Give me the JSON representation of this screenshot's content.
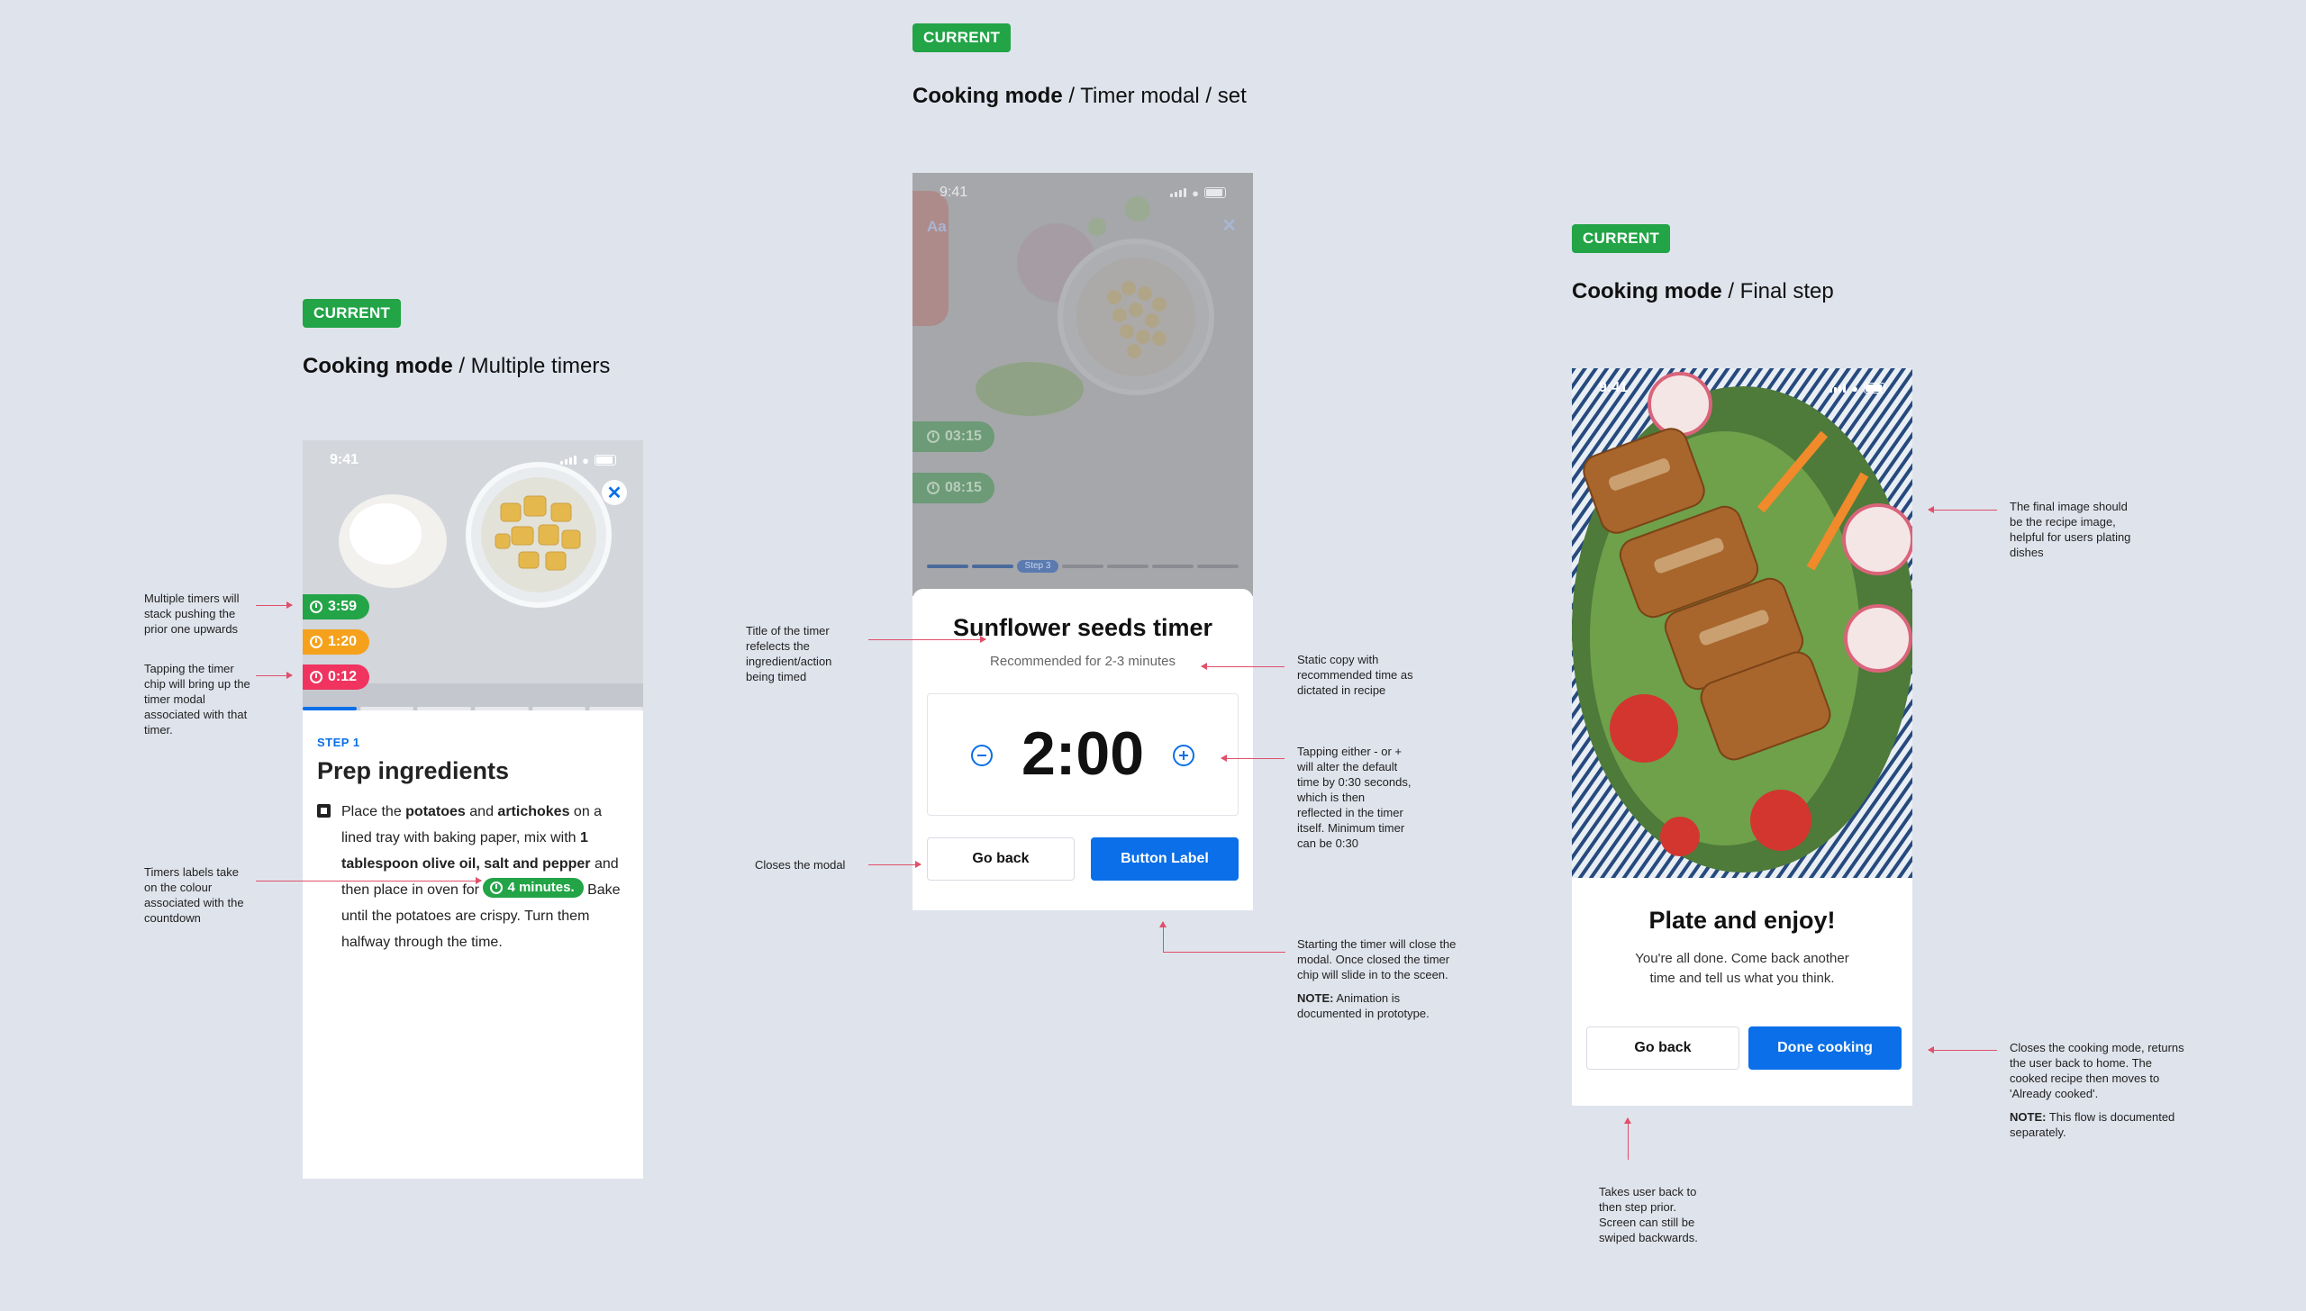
{
  "badge": "CURRENT",
  "colors": {
    "accent_blue": "#0a6fe8",
    "green": "#22a447",
    "orange": "#f5a11c",
    "pink": "#f0335f",
    "annotation": "#e0506a",
    "background": "#dfe3ec"
  },
  "frame1": {
    "title_bold": "Cooking mode",
    "title_rest": " / Multiple timers",
    "status_time": "9:41",
    "close_icon": "close-icon",
    "chips": [
      "3:59",
      "1:20",
      "0:12"
    ],
    "step_label": "STEP 1",
    "step_title": "Prep ingredients",
    "instr": {
      "t1": "Place the ",
      "b1": "potatoes",
      "t2": " and ",
      "b2": "artichokes",
      "t3": " on a lined tray with baking paper, mix with ",
      "b3": "1 tablespoon olive oil, salt and pepper",
      "t4": " and then place in oven for ",
      "chip": "4 minutes.",
      "t5": " Bake until the potatoes are crispy. Turn them halfway through the time."
    },
    "notes": {
      "n1": "Multiple timers will stack pushing the prior one upwards",
      "n2": "Tapping the timer chip will bring up the timer modal associated with that timer.",
      "n3": "Timers labels take on the colour associated with the countdown"
    }
  },
  "frame2": {
    "title_bold": "Cooking mode",
    "title_rest": " / Timer modal / set",
    "status_time": "9:41",
    "aa": "Aa",
    "chips": [
      "03:15",
      "08:15"
    ],
    "step_pill": "Step 3",
    "modal_title": "Sunflower seeds timer",
    "modal_sub": "Recommended for 2-3 minutes",
    "time": "2:00",
    "go_back": "Go back",
    "button_label": "Button Label",
    "notes": {
      "title": "Title of the timer refelects the ingredient/action being timed",
      "close": "Closes the modal",
      "static": "Static copy with recommended time as dictated in recipe",
      "tapping": "Tapping either - or + will alter the default time by 0:30 seconds, which is then reflected in the timer itself. Minimum timer can be 0:30",
      "start": "Starting the timer will close the modal. Once closed the timer chip will slide in to the sceen.",
      "note_label": "NOTE:",
      "note_text": " Animation is documented in prototype."
    }
  },
  "frame3": {
    "title_bold": "Cooking mode",
    "title_rest": " / Final step",
    "status_time": "9:41",
    "plate_title": "Plate and enjoy!",
    "plate_text": "You're all done. Come back another time and tell us what you think.",
    "go_back": "Go back",
    "done": "Done cooking",
    "notes": {
      "image": "The final image should be the recipe image, helpful for users plating dishes",
      "done": "Closes the cooking mode, returns the user back to home. The cooked recipe then moves to 'Already cooked'.",
      "note_label": "NOTE:",
      "note_text": " This flow is documented separately.",
      "back": "Takes user back to then step prior. Screen can still be swiped backwards."
    }
  }
}
